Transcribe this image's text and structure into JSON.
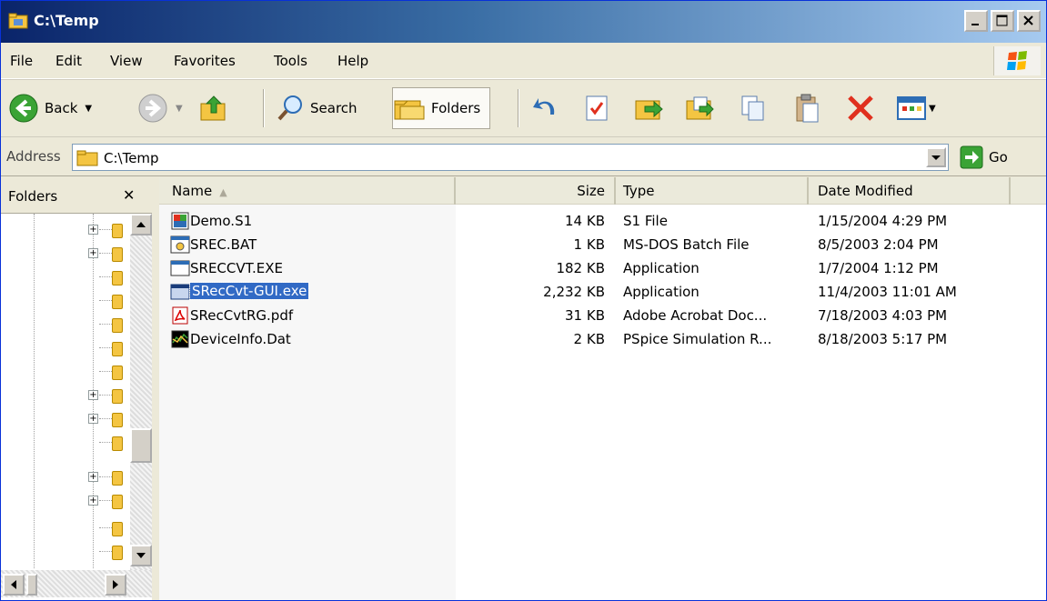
{
  "window": {
    "title": "C:\\Temp"
  },
  "menu": [
    "File",
    "Edit",
    "View",
    "Favorites",
    "Tools",
    "Help"
  ],
  "toolbar": {
    "back_label": "Back",
    "search_label": "Search",
    "folders_label": "Folders"
  },
  "address": {
    "label": "Address",
    "value": "C:\\Temp",
    "go_label": "Go"
  },
  "folders_pane": {
    "title": "Folders",
    "close": "✕"
  },
  "columns": {
    "name": "Name",
    "size": "Size",
    "type": "Type",
    "date": "Date Modified"
  },
  "files": [
    {
      "icon": "s1-file-icon",
      "name": "Demo.S1",
      "size": "14 KB",
      "type": "S1 File",
      "date": "1/15/2004 4:29 PM",
      "selected": false
    },
    {
      "icon": "batch-file-icon",
      "name": "SREC.BAT",
      "size": "1 KB",
      "type": "MS-DOS Batch File",
      "date": "8/5/2003 2:04 PM",
      "selected": false
    },
    {
      "icon": "application-icon",
      "name": "SRECCVT.EXE",
      "size": "182 KB",
      "type": "Application",
      "date": "1/7/2004 1:12 PM",
      "selected": false
    },
    {
      "icon": "application-icon",
      "name": "SRecCvt-GUI.exe",
      "size": "2,232 KB",
      "type": "Application",
      "date": "11/4/2003 11:01 AM",
      "selected": true
    },
    {
      "icon": "pdf-icon",
      "name": "SRecCvtRG.pdf",
      "size": "31 KB",
      "type": "Adobe Acrobat Doc...",
      "date": "7/18/2003 4:03 PM",
      "selected": false
    },
    {
      "icon": "pspice-data-icon",
      "name": "DeviceInfo.Dat",
      "size": "2 KB",
      "type": "PSpice Simulation R...",
      "date": "8/18/2003 5:17 PM",
      "selected": false
    }
  ],
  "colors": {
    "selection": "#316ac5",
    "title_gradient_start": "#0a246a"
  }
}
